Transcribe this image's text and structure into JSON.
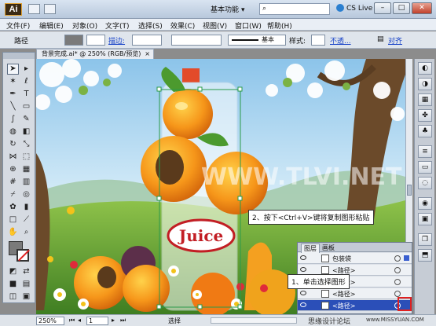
{
  "app": {
    "logo": "Ai",
    "workspace": "基本功能",
    "cs_live": "CS Live"
  },
  "window_buttons": [
    "–",
    "□",
    "✕"
  ],
  "menu": [
    "文件(F)",
    "编辑(E)",
    "对象(O)",
    "文字(T)",
    "选择(S)",
    "效果(C)",
    "视图(V)",
    "窗口(W)",
    "帮助(H)"
  ],
  "control_bar": {
    "object_type": "路径",
    "stroke_link": "描边:",
    "brush_style": "基本",
    "style_label": "样式:",
    "opacity_link": "不透...",
    "align_link": "对齐"
  },
  "document_tab": {
    "title": "背景完成.ai* @ 250% (RGB/预览)",
    "close": "×"
  },
  "canvas": {
    "watermark_text": "WWW.TLVI.NET",
    "juice_label": "Juice"
  },
  "callouts": {
    "step2": "2、按下<Ctrl+V>键将复制图形粘贴",
    "step1": "1、单击选择图形"
  },
  "layers_panel": {
    "tabs": [
      "图层",
      "画板"
    ],
    "rows": [
      {
        "name": "包装袋"
      },
      {
        "name": "<路径>"
      },
      {
        "name": "<路径>"
      },
      {
        "name": "<路径>"
      },
      {
        "name": "<路径>"
      }
    ]
  },
  "status": {
    "zoom": "250%",
    "page": "1",
    "tool": "选择",
    "forum_watermark": "思缘设计论坛",
    "site_watermark": "www.MISSYUAN.COM"
  },
  "colors": {
    "selection": "#2b9a4a",
    "accent_red": "#e02020",
    "layer_highlight": "#2b4fb8"
  }
}
